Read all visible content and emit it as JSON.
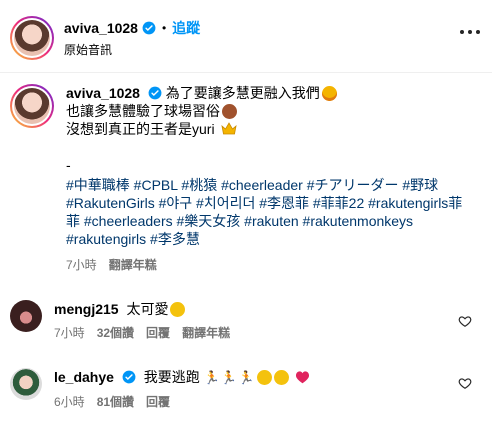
{
  "post_header": {
    "username": "aviva_1028",
    "separator": "•",
    "follow_label": "追蹤",
    "subtitle": "原始音訊"
  },
  "caption": {
    "username": "aviva_1028",
    "lines": [
      "為了要讓多慧更融入我們",
      "也讓多慧體驗了球場習俗",
      "沒想到真正的王者是yuri",
      "",
      "-"
    ],
    "hashtag_lines": [
      "#中華職棒 #CPBL #桃猿 #cheerleader #チアリーダー #野球",
      "#RakutenGirls #야구 #치어리더 #李恩菲 #菲菲22 #rakutengirls菲",
      "菲 #cheerleaders #樂天女孩 #rakuten #rakutenmonkeys",
      "#rakutengirls #李多慧"
    ],
    "time": "7小時",
    "translate": "翻譯年糕"
  },
  "comments": [
    {
      "username": "mengj215",
      "text": "太可愛",
      "time": "7小時",
      "likes": "32個讚",
      "reply": "回覆",
      "translate": "翻譯年糕"
    },
    {
      "username": "le_dahye",
      "text": "我要逃跑",
      "time": "6小時",
      "likes": "81個讚",
      "reply": "回覆"
    }
  ],
  "colors": {
    "link": "#00376b",
    "follow": "#0095f6",
    "muted": "#737373",
    "verified": "#0095f6"
  }
}
